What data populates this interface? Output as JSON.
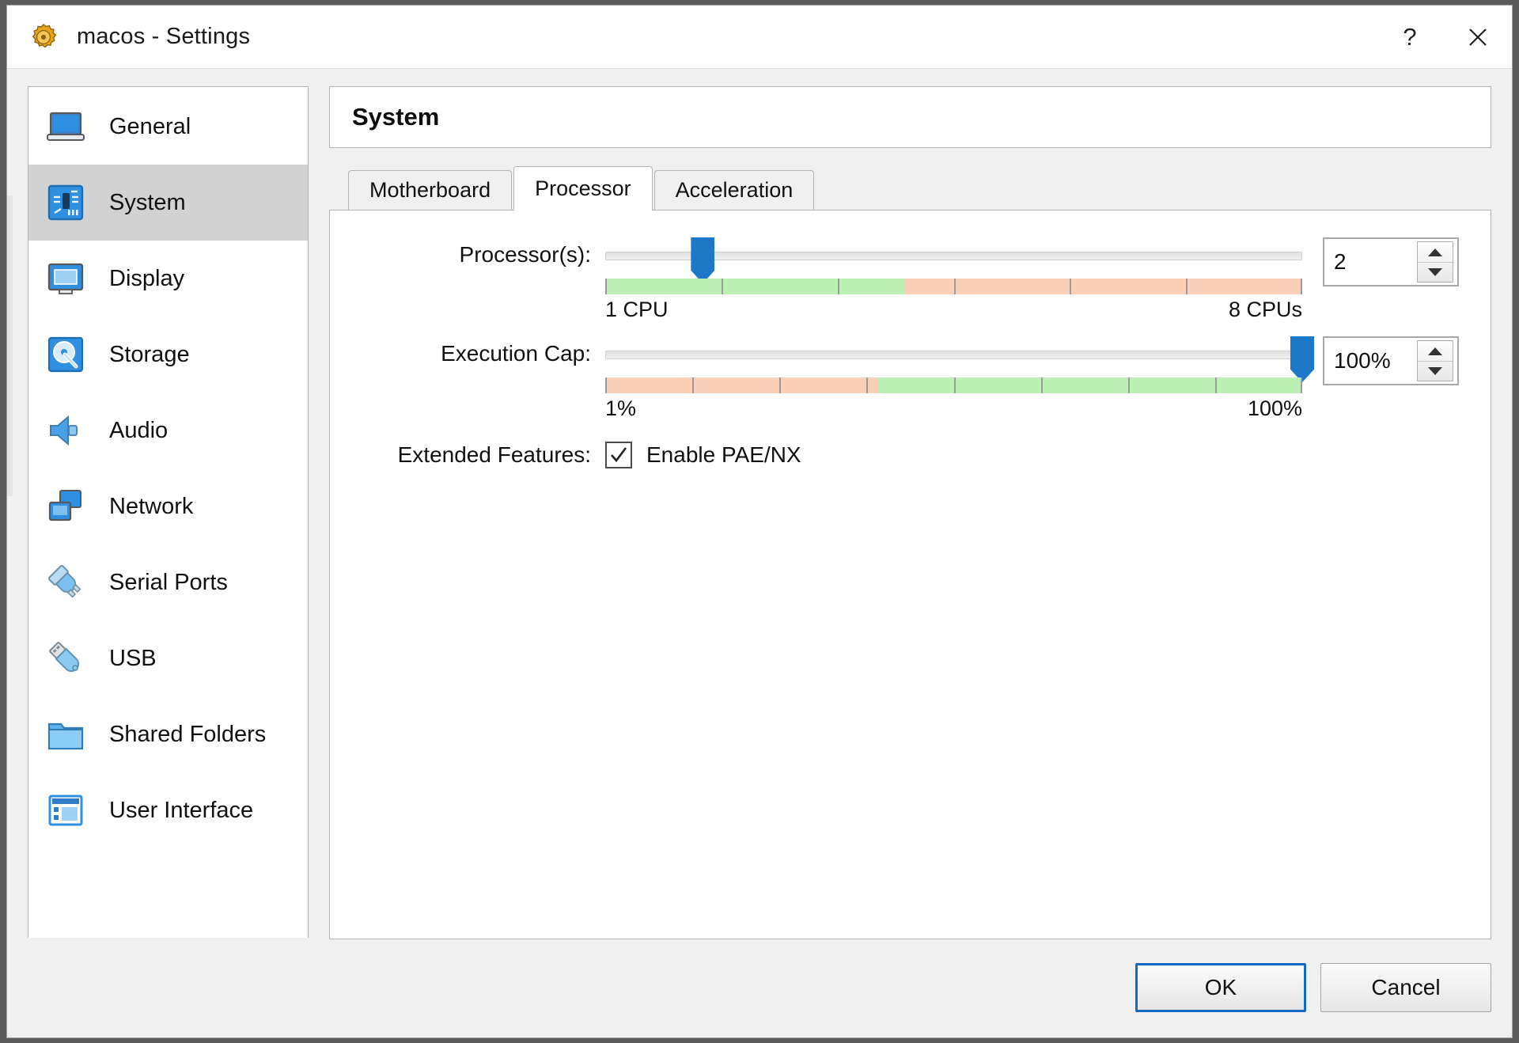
{
  "window": {
    "title": "macos - Settings",
    "icon": "settings-gear-icon",
    "help_label": "?",
    "close_label": "✕"
  },
  "sidebar": {
    "items": [
      {
        "label": "General",
        "icon": "laptop-icon",
        "selected": false
      },
      {
        "label": "System",
        "icon": "system-chip-icon",
        "selected": true
      },
      {
        "label": "Display",
        "icon": "monitor-icon",
        "selected": false
      },
      {
        "label": "Storage",
        "icon": "hard-disk-icon",
        "selected": false
      },
      {
        "label": "Audio",
        "icon": "speaker-icon",
        "selected": false
      },
      {
        "label": "Network",
        "icon": "network-cards-icon",
        "selected": false
      },
      {
        "label": "Serial Ports",
        "icon": "serial-plug-icon",
        "selected": false
      },
      {
        "label": "USB",
        "icon": "usb-stick-icon",
        "selected": false
      },
      {
        "label": "Shared Folders",
        "icon": "folder-icon",
        "selected": false
      },
      {
        "label": "User Interface",
        "icon": "window-layout-icon",
        "selected": false
      }
    ]
  },
  "pane": {
    "title": "System",
    "tabs": [
      {
        "label": "Motherboard",
        "active": false
      },
      {
        "label": "Processor",
        "active": true
      },
      {
        "label": "Acceleration",
        "active": false
      }
    ]
  },
  "processor": {
    "label": "Processor(s):",
    "value": "2",
    "min_label": "1 CPU",
    "max_label": "8 CPUs",
    "handle_percent": 14,
    "green_percent": 43,
    "orange_percent": 57,
    "tick_count": 7
  },
  "execution_cap": {
    "label": "Execution Cap:",
    "value": "100%",
    "min_label": "1%",
    "max_label": "100%",
    "handle_percent": 100,
    "orange_percent": 39,
    "green_percent": 61,
    "tick_count": 9
  },
  "extended_features": {
    "label": "Extended Features:",
    "checkbox_label": "Enable PAE/NX",
    "checked": true
  },
  "footer": {
    "ok_label": "OK",
    "cancel_label": "Cancel"
  },
  "colors": {
    "green": "#bdf0b4",
    "orange": "#fad1b8",
    "handle_blue": "#1d78c8",
    "accent_blue": "#1666c4",
    "selected_row": "#d2d2d2"
  }
}
